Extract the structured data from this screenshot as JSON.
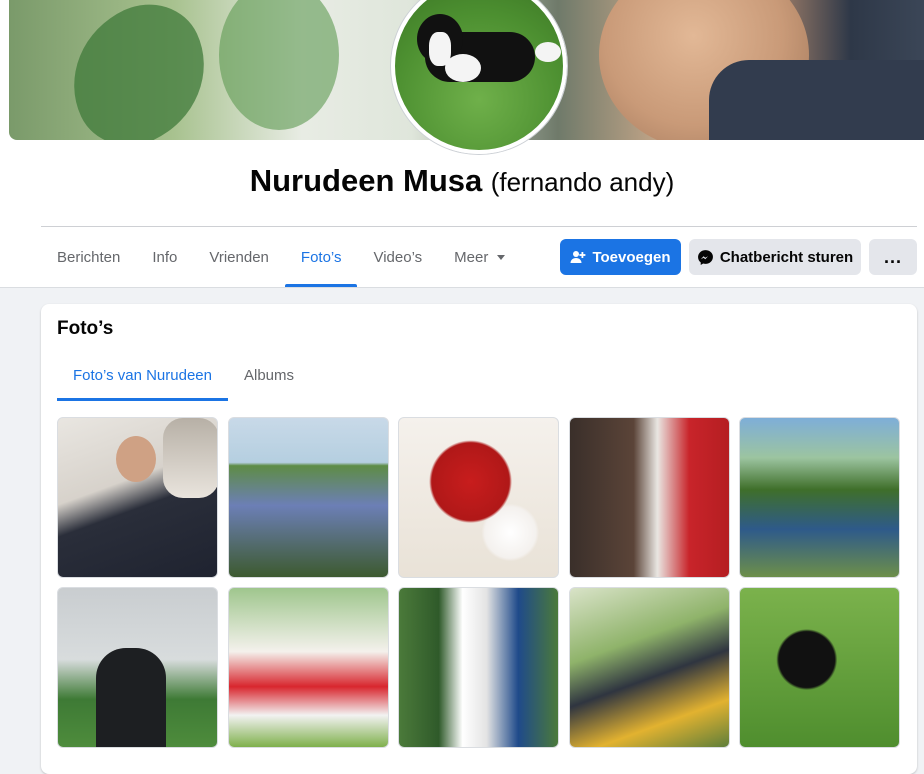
{
  "profile": {
    "name": "Nurudeen Musa",
    "alternate_name": "(fernando andy)",
    "cover_alt": "cover-photo",
    "avatar_alt": "profile-picture"
  },
  "tabs": [
    {
      "label": "Berichten",
      "active": false
    },
    {
      "label": "Info",
      "active": false
    },
    {
      "label": "Vrienden",
      "active": false
    },
    {
      "label": "Foto’s",
      "active": true
    },
    {
      "label": "Video’s",
      "active": false
    },
    {
      "label": "Meer",
      "active": false
    }
  ],
  "actions": {
    "add_friend": "Toevoegen",
    "message": "Chatbericht sturen",
    "more": "..."
  },
  "photos_section": {
    "title": "Foto’s",
    "subtabs": [
      {
        "label": "Foto’s van Nurudeen",
        "active": true
      },
      {
        "label": "Albums",
        "active": false
      }
    ],
    "photo_count": 10
  },
  "colors": {
    "accent": "#1b74e4",
    "secondary_button": "#e4e6eb",
    "muted_text": "#65676b",
    "page_bg": "#f0f2f5"
  },
  "icons": {
    "add_friend": "person-plus-icon",
    "message": "messenger-icon",
    "more_caret": "caret-down-icon"
  }
}
